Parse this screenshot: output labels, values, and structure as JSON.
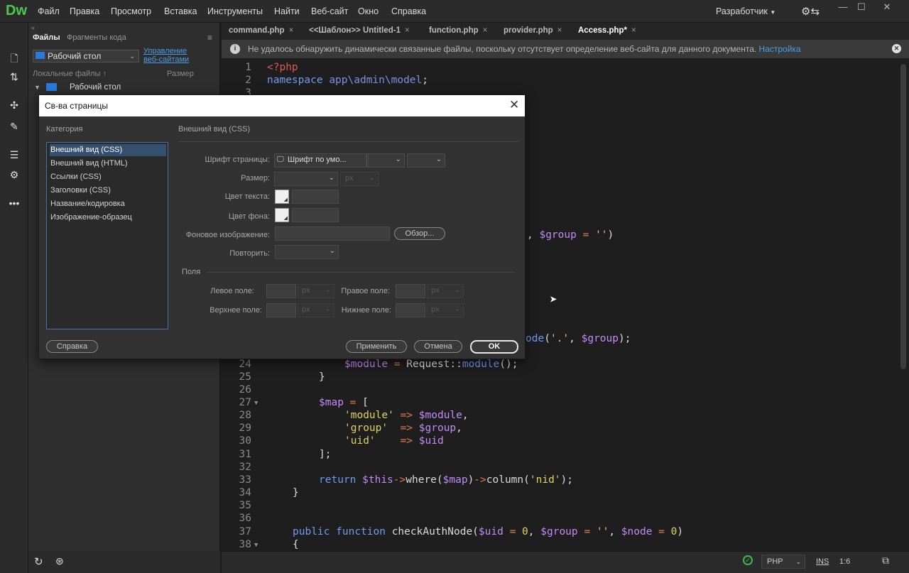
{
  "app": {
    "logo": "Dw",
    "menu": [
      "Файл",
      "Правка",
      "Просмотр",
      "Вставка",
      "Инструменты",
      "Найти",
      "Веб-сайт",
      "Окно",
      "Справка"
    ],
    "workspace": "Разработчик"
  },
  "files_panel": {
    "tabs": [
      "Файлы",
      "Фрагменты кода"
    ],
    "site_select": "Рабочий стол",
    "manage_link_line1": "Управление",
    "manage_link_line2": "веб-сайтами",
    "col_local": "Локальные файлы",
    "col_size": "Размер",
    "tree_root": "Рабочий стол"
  },
  "editor": {
    "tabs": [
      {
        "label": "command.php",
        "active": false
      },
      {
        "label": "<<Шаблон>> Untitled-1",
        "active": false
      },
      {
        "label": "function.php",
        "active": false
      },
      {
        "label": "provider.php",
        "active": false
      },
      {
        "label": "Access.php*",
        "active": true
      }
    ],
    "tab_close": "×",
    "info_text": "Не удалось обнаружить динамически связанные файлы, поскольку отсутствует определение веб-сайта для данного документа.",
    "info_link": "Настройка",
    "status": {
      "language": "PHP",
      "mode": "INS",
      "position": "1:6"
    }
  },
  "code_lines": {
    "l1": "1",
    "l2": "2",
    "l3": "3",
    "l24": "24",
    "l25": "25",
    "l26": "26",
    "l27": "27",
    "l28": "28",
    "l29": "29",
    "l30": "30",
    "l31": "31",
    "l32": "32",
    "l33": "33",
    "l34": "34",
    "l35": "35",
    "l36": "36",
    "l37": "37",
    "l38": "38"
  },
  "dialog": {
    "title": "Св-ва страницы",
    "category_label": "Категория",
    "categories": [
      "Внешний вид (CSS)",
      "Внешний вид (HTML)",
      "Ссылки (CSS)",
      "Заголовки (CSS)",
      "Название/кодировка",
      "Изображение-образец"
    ],
    "section_title": "Внешний вид (CSS)",
    "font_label": "Шрифт страницы:",
    "font_value": "Шрифт по умо...",
    "size_label": "Размер:",
    "size_unit": "px",
    "text_color_label": "Цвет текста:",
    "bg_color_label": "Цвет фона:",
    "bg_image_label": "Фоновое изображение:",
    "browse_label": "Обзор...",
    "repeat_label": "Повторить:",
    "margins_title": "Поля",
    "left_margin": "Левое поле:",
    "right_margin": "Правое поле:",
    "top_margin": "Верхнее поле:",
    "bottom_margin": "Нижнее поле:",
    "unit_px": "px",
    "help_btn": "Справка",
    "apply_btn": "Применить",
    "cancel_btn": "Отмена",
    "ok_btn": "OK",
    "close_glyph": "✕"
  },
  "colors": {
    "logo_green": "#4ec950",
    "link_blue": "#4a9ee8",
    "keyword": "#6f9bf2",
    "variable": "#c58af9",
    "string": "#e0d25c"
  }
}
